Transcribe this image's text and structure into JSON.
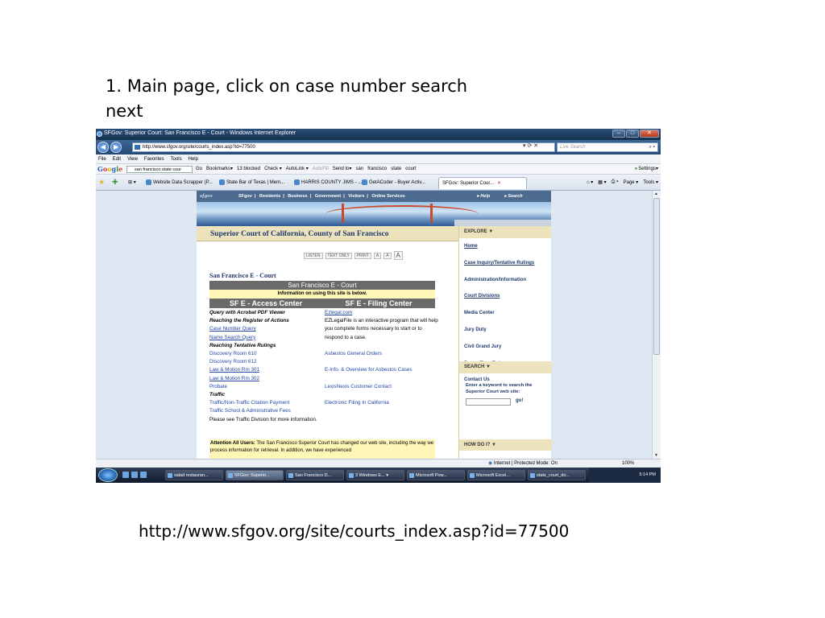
{
  "slide": {
    "caption": "1. Main page, click on case number search next",
    "url": "http://www.sfgov.org/site/courts_index.asp?id=77500"
  },
  "browser": {
    "window_title": "SFGov: Superior Court: San Francisco E - Court - Windows Internet Explorer",
    "address": "http://www.sfgov.org/site/courts_index.asp?id=77500",
    "live_search_placeholder": "Live Search",
    "menu": [
      "File",
      "Edit",
      "View",
      "Favorites",
      "Tools",
      "Help"
    ],
    "google_toolbar": {
      "logo": "Google",
      "search_value": "san francisco state cour",
      "go": "Go",
      "items": [
        "Bookmarks▾",
        "13 blocked",
        "Check ▾",
        "AutoLink ▾",
        "AutoFill",
        "Send to▾",
        "san",
        "francisco",
        "state",
        "court"
      ],
      "settings": "Settings▾"
    },
    "favorites": [
      "Website Data Scrapper (P...",
      "State Bar of Texas | Mem...",
      "HARRIS COUNTY JIMS - ...",
      "GetACoder - Buyer Activ..."
    ],
    "active_tab": "SFGov: Superior Cour...",
    "command_bar": [
      "Page ▾",
      "Tools ▾"
    ],
    "status": {
      "zone": "Internet | Protected Mode: On",
      "zoom": "100%"
    }
  },
  "site": {
    "logo": "sfgov",
    "nav": [
      "SFgov",
      "Residents",
      "Business",
      "Government",
      "Visitors",
      "Online Services"
    ],
    "help": "▸ Help",
    "search": "▸ Search",
    "court_title": "Superior Court of California, County of San Francisco",
    "utility": [
      "LISTEN",
      "TEXT ONLY",
      "PRINT",
      "A",
      "A",
      "A"
    ],
    "ecourt_title": "San Francisco E - Court",
    "table_title": "San Francisco E - Court",
    "table_info": "Information on using this site is below.",
    "access_center": "SF E - Access Center",
    "filing_center": "SF E - Filing Center",
    "left_col": {
      "query_acrobat": "Query with Acrobat PDF Viewer",
      "reaching_register": "Reaching the Register of Actions",
      "case_number_query": "Case Number Query",
      "name_search_query": "Name Search Query",
      "reaching_rulings": "Reaching Tentative Rulings",
      "discovery_610": "Discovery Room 610",
      "discovery_612": "Discovery Room 612",
      "law_motion_301": "Law & Motion Rm 301",
      "law_motion_302": "Law & Motion Rm 302",
      "probate": "Probate",
      "traffic": "Traffic",
      "traffic_citation": "Traffic/Non-Traffic Citation Payment",
      "traffic_school": "Traffic School & Administrative Fees",
      "traffic_note": "Please see Traffic Division for more information."
    },
    "right_col": {
      "ezlegal": "Ezlegal.com",
      "ezlegal_desc": "EZLegalFile is an interactive program that will help you complete forms necessary to start or to respond to a case.",
      "asbestos": "Asbestos General Orders",
      "einfo": "E-Info. & Overview for Asbestos Cases",
      "lexis": "LexisNexis Customer Contact",
      "efiling": "Electronic Filing In California"
    },
    "attention_label": "Attention All Users:",
    "attention_text": "The San Francisco Superior Court has changed our web site, including the way we process information for retrieval. In addition, we have experienced",
    "explore": {
      "header": "EXPLORE ▼",
      "items": [
        "Home",
        "Case Inquiry/Tentative Rulings",
        "Administration/Information",
        "Court Divisions",
        "Media Center",
        "Jury Duty",
        "Civil Grand Jury",
        "Forms/Fees/Rules",
        "Contact Us"
      ],
      "search_header": "SEARCH ▼",
      "search_text": "Enter a keyword to search the Superior Court web site:",
      "go": "go!",
      "howdo_header": "HOW DO I? ▼"
    }
  },
  "taskbar": {
    "tasks": [
      "salad restauran...",
      "SFGov: Superio...",
      "San Francisco D...",
      "3 Windows E... ▾",
      "Microsoft Pow...",
      "Microsoft Excel...",
      "state_court_do..."
    ],
    "clock": "5:14 PM"
  }
}
